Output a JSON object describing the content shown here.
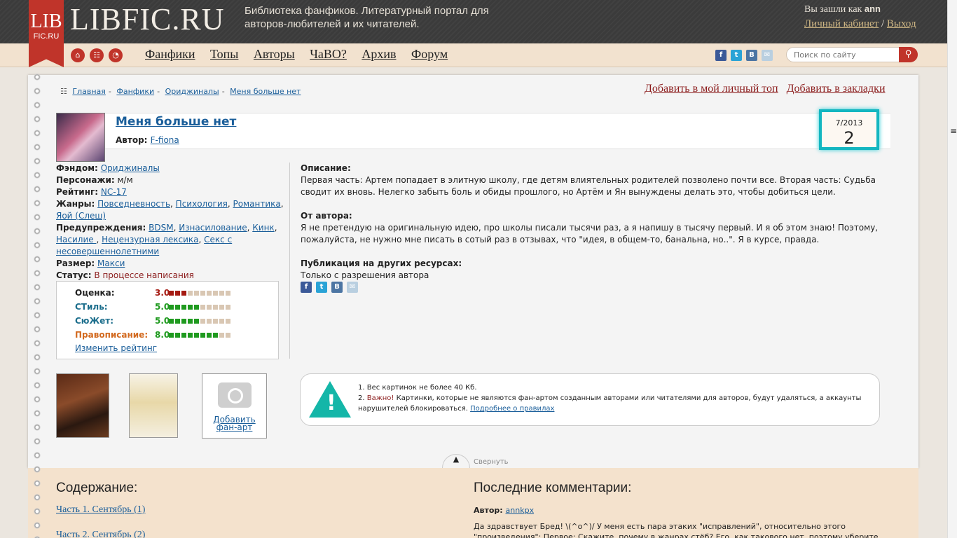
{
  "header": {
    "logo_big": "LIB",
    "logo_small": "FIC.RU",
    "site_name": "LIBFIC.RU",
    "tagline": "Библиотека фанфиков. Литературный портал для авторов-любителей и их читателей.",
    "login_prefix": "Вы зашли как",
    "username": "ann",
    "cabinet": "Личный кабинет",
    "separator": "/",
    "logout": "Выход"
  },
  "nav": {
    "items": [
      "Фанфики",
      "Топы",
      "Авторы",
      "ЧаВО?",
      "Архив",
      "Форум"
    ],
    "search_placeholder": "Поиск по сайту"
  },
  "breadcrumb": [
    "Главная",
    "Фанфики",
    "Ориджиналы",
    "Меня больше нет"
  ],
  "actions": {
    "add_top": "Добавить в мой личный топ",
    "add_bookmarks": "Добавить в закладки"
  },
  "fic": {
    "title": "Меня больше нет",
    "author_label": "Автор:",
    "author": "F-fiona",
    "date": "7/2013",
    "chapters": "2"
  },
  "meta": {
    "fandom_label": "Фэндом:",
    "fandom": "Ориджиналы",
    "chars_label": "Персонажи:",
    "chars": "м/м",
    "rating_label": "Рейтинг:",
    "rating": "NC-17",
    "genres_label": "Жанры:",
    "genres": [
      "Повседневность",
      "Психология",
      "Романтика",
      "Яой (Слеш)"
    ],
    "warnings_label": "Предупреждения:",
    "warnings": [
      "BDSM",
      "Изнасилование",
      "Кинк",
      "Насилие ",
      "Нецензурная лексика",
      "Секс с несовершеннолетними"
    ],
    "size_label": "Размер:",
    "size": "Макси",
    "status_label": "Статус:",
    "status": "В процессе написания"
  },
  "ratings": {
    "rows": [
      {
        "label": "Оценка:",
        "value": "3.0",
        "score": 3,
        "color": "#a51a12",
        "label_color": "#222222"
      },
      {
        "label": "СТиль:",
        "value": "5.0",
        "score": 5,
        "color": "#1f9a1f",
        "label_color": "#1c6e8c"
      },
      {
        "label": "СюЖет:",
        "value": "5.0",
        "score": 5,
        "color": "#1f9a1f",
        "label_color": "#1c6e8c"
      },
      {
        "label": "Правописание:",
        "value": "8.0",
        "score": 8,
        "color": "#1f9a1f",
        "label_color": "#d2691e"
      }
    ],
    "change": "Изменить рейтинг"
  },
  "description": {
    "desc_title": "Описание:",
    "desc_text": "Первая часть: Артем попадает в элитную школу, где детям влиятельных родителей позволено почти все. Вторая часть: Судьба сводит их вновь. Нелегко забыть боль и обиды прошлого, но Артём и Ян вынуждены делать это, чтобы добиться цели.",
    "author_title": "От автора:",
    "author_text": "Я не претендую на оригинальную идею, про школы писали тысячи раз, а я напишу в тысячу первый. И я об этом знаю! Поэтому, пожалуйста, не нужно мне писать в сотый раз в отзывах, что \"идея, в общем-то, банальна, но..\". Я в курсе, правда.",
    "pub_title": "Публикация на других ресурсах:",
    "pub_text": "Только с разрешения автора"
  },
  "fanart": {
    "add": "Добавить фан-арт"
  },
  "notice": {
    "line1": "1. Вес картинок не более 40 Кб.",
    "line2_num": "2.",
    "line2_important": "Важно!",
    "line2_text": "Картинки, которые не являются фан-артом созданным авторами или читателями для авторов, будут удаляться, а аккаунты нарушителей блокироваться.",
    "more": "Подробнее о правилах"
  },
  "collapse": "Свернуть",
  "contents": {
    "title": "Содержание:",
    "chapters": [
      "Часть 1. Сентябрь (1)",
      "Часть 2. Сентябрь (2)"
    ]
  },
  "comments": {
    "title": "Последние комментарии:",
    "author_label": "Автор:",
    "author": "annkpx",
    "text": "Да здравствует Бред! \\(^o^)/ У меня есть пара этаких \"исправлений\", относительно этого \"произведения\": Первое: Скажите, почему в жанрах стёб? Его, как такового нет, поэтому уберите его из шапки. Второе: Поверхностно. Нет"
  },
  "colors": {
    "brand_red": "#c0342a",
    "accent_teal": "#14b6c0",
    "link": "#1a5e9a",
    "dark_red": "#8b1c1c"
  }
}
